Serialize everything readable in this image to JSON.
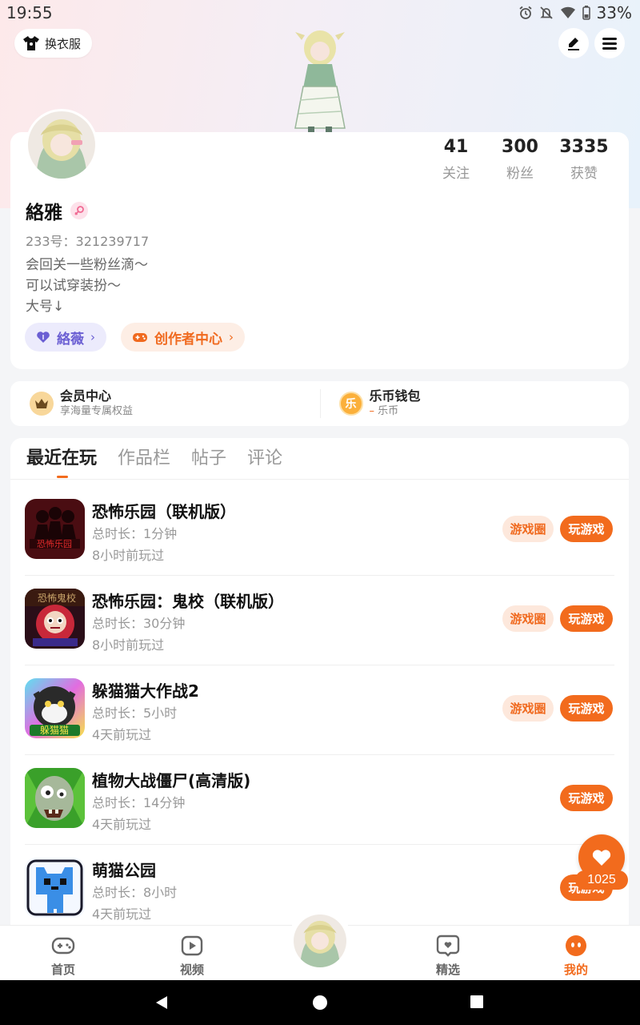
{
  "status_bar": {
    "time": "19:55",
    "battery": "33%"
  },
  "header": {
    "outfit_label": "换衣服"
  },
  "profile": {
    "stats": [
      {
        "value": "41",
        "label": "关注"
      },
      {
        "value": "300",
        "label": "粉丝"
      },
      {
        "value": "3335",
        "label": "获赞"
      }
    ],
    "name": "絡雅",
    "uid": "233号：321239717",
    "bio": [
      "会回关一些粉丝滴～",
      "可以试穿装扮～",
      "大号↓"
    ],
    "tags": [
      {
        "label": "絡薇",
        "color": "#6b5fd3"
      },
      {
        "label": "创作者中心",
        "color": "#f06a1f"
      }
    ]
  },
  "member": {
    "vip": {
      "title": "会员中心",
      "subtitle": "享海量专属权益"
    },
    "wallet": {
      "title": "乐币钱包",
      "dash": "–",
      "subtitle": "乐币",
      "icon_char": "乐"
    }
  },
  "tabs": [
    "最近在玩",
    "作品栏",
    "帖子",
    "评论"
  ],
  "games": [
    {
      "title": "恐怖乐园（联机版）",
      "duration": "总时长：1分钟",
      "last_played": "8小时前玩过",
      "circle_label": "游戏圈",
      "play_label": "玩游戏",
      "has_circle": true
    },
    {
      "title": "恐怖乐园：鬼校（联机版）",
      "duration": "总时长：30分钟",
      "last_played": "8小时前玩过",
      "circle_label": "游戏圈",
      "play_label": "玩游戏",
      "has_circle": true
    },
    {
      "title": "躲猫猫大作战2",
      "duration": "总时长：5小时",
      "last_played": "4天前玩过",
      "circle_label": "游戏圈",
      "play_label": "玩游戏",
      "has_circle": true
    },
    {
      "title": "植物大战僵尸(高清版)",
      "duration": "总时长：14分钟",
      "last_played": "4天前玩过",
      "play_label": "玩游戏",
      "has_circle": false
    },
    {
      "title": "萌猫公园",
      "duration": "总时长：8小时",
      "last_played": "4天前玩过",
      "play_label": "玩游戏",
      "has_circle": false
    }
  ],
  "float_like": {
    "count": "1025"
  },
  "bottom_nav": [
    {
      "label": "首页"
    },
    {
      "label": "视频"
    },
    {
      "label": "精选"
    },
    {
      "label": "我的"
    }
  ],
  "colors": {
    "accent": "#f26b1d",
    "purple": "#6b5fd3"
  }
}
